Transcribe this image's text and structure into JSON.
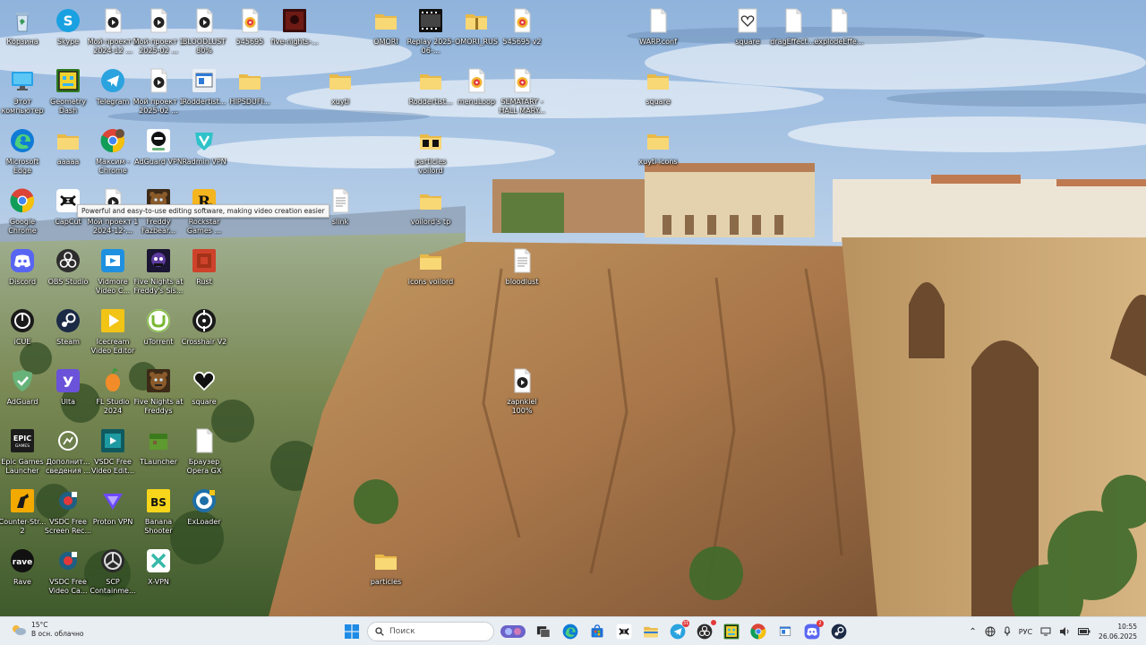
{
  "desktop": {
    "tooltip": "Powerful and easy-to-use editing software, making video creation easier",
    "icons": [
      {
        "label": "Корзина",
        "icon": "recycle-bin-icon",
        "kind": "bin"
      },
      {
        "label": "Skype",
        "icon": "skype-icon",
        "kind": "skype"
      },
      {
        "label": "Мой проект 1 2024-12 ...",
        "icon": "video-file-icon",
        "kind": "video"
      },
      {
        "label": "Мой проект 1 2025-02 ...",
        "icon": "video-file-icon",
        "kind": "video"
      },
      {
        "label": "BLOODLUST 80%",
        "icon": "video-file-icon",
        "kind": "video"
      },
      {
        "label": "545695",
        "icon": "audio-file-icon",
        "kind": "audio"
      },
      {
        "label": "five-nights-...",
        "icon": "game-thumbnail-icon",
        "kind": "thumb"
      },
      {
        "label": "OMORI",
        "icon": "folder-icon",
        "kind": "folder"
      },
      {
        "label": "Replay 2025-06-...",
        "icon": "video-thumbnail-icon",
        "kind": "film"
      },
      {
        "label": "OMORI_RUS",
        "icon": "zip-folder-icon",
        "kind": "zip"
      },
      {
        "label": "545695 v2",
        "icon": "audio-file-icon",
        "kind": "audio"
      },
      {
        "label": "WARP.conf",
        "icon": "file-icon",
        "kind": "file"
      },
      {
        "label": "square",
        "icon": "heart-file-icon",
        "kind": "heartfile"
      },
      {
        "label": "dragEffect....",
        "icon": "file-icon",
        "kind": "file"
      },
      {
        "label": "explodeEffe...",
        "icon": "file-icon",
        "kind": "file"
      },
      {
        "label": "Этот компьютер",
        "icon": "this-pc-icon",
        "kind": "pc"
      },
      {
        "label": "Geometry Dash",
        "icon": "geometry-dash-icon",
        "kind": "gd"
      },
      {
        "label": "Telegram",
        "icon": "telegram-icon",
        "kind": "telegram"
      },
      {
        "label": "Мой проект 1 2025-02 ...",
        "icon": "video-file-icon",
        "kind": "video"
      },
      {
        "label": "Roddertist...",
        "icon": "app-window-icon",
        "kind": "window"
      },
      {
        "label": "HIPSDUFI...",
        "icon": "folder-icon",
        "kind": "folder"
      },
      {
        "label": "xuyti",
        "icon": "folder-icon",
        "kind": "folder"
      },
      {
        "label": "Roddertist...",
        "icon": "folder-icon",
        "kind": "folder"
      },
      {
        "label": "menuLoop",
        "icon": "audio-file-icon",
        "kind": "audio"
      },
      {
        "label": "SEMATARY - HALL MARY...",
        "icon": "audio-file-icon",
        "kind": "audio"
      },
      {
        "label": "square",
        "icon": "folder-icon",
        "kind": "folder"
      },
      {
        "label": "Microsoft Edge",
        "icon": "edge-icon",
        "kind": "edge"
      },
      {
        "label": "ааааа",
        "icon": "folder-icon",
        "kind": "folder"
      },
      {
        "label": "Максим - Chrome",
        "icon": "chrome-profile-icon",
        "kind": "chromeprof"
      },
      {
        "label": "AdGuard VPN",
        "icon": "adguard-vpn-icon",
        "kind": "adguardvpn"
      },
      {
        "label": "Radmin VPN",
        "icon": "radmin-vpn-icon",
        "kind": "radmin"
      },
      {
        "label": "particles voilord",
        "icon": "folder-icon",
        "kind": "folderdark"
      },
      {
        "label": "xuyti icons",
        "icon": "folder-icon",
        "kind": "folder"
      },
      {
        "label": "Google Chrome",
        "icon": "chrome-icon",
        "kind": "chrome"
      },
      {
        "label": "CapCut",
        "icon": "capcut-icon",
        "kind": "capcut"
      },
      {
        "label": "Мой проект 1 2024-12-...",
        "icon": "video-file-icon",
        "kind": "video"
      },
      {
        "label": "Freddy Fazbear...",
        "icon": "fnaf-icon",
        "kind": "freddy"
      },
      {
        "label": "Rockstar Games ...",
        "icon": "rockstar-icon",
        "kind": "rockstar"
      },
      {
        "label": "slink",
        "icon": "text-file-icon",
        "kind": "textfile"
      },
      {
        "label": "voilord's tp",
        "icon": "folder-icon",
        "kind": "folder"
      },
      {
        "label": "Discord",
        "icon": "discord-icon",
        "kind": "discord"
      },
      {
        "label": "OBS Studio",
        "icon": "obs-icon",
        "kind": "obs"
      },
      {
        "label": "Vidmore Video C...",
        "icon": "vidmore-icon",
        "kind": "vidmore"
      },
      {
        "label": "Five Nights at Freddy's Sis...",
        "icon": "fnaf-sl-icon",
        "kind": "fnafsl"
      },
      {
        "label": "Rust",
        "icon": "rust-icon",
        "kind": "rust"
      },
      {
        "label": "icons voilord",
        "icon": "folder-icon",
        "kind": "folder"
      },
      {
        "label": "bloodlust",
        "icon": "text-file-icon",
        "kind": "textfile"
      },
      {
        "label": "iCUE",
        "icon": "icue-icon",
        "kind": "icue"
      },
      {
        "label": "Steam",
        "icon": "steam-icon",
        "kind": "steam"
      },
      {
        "label": "Icecream Video Editor",
        "icon": "icecream-icon",
        "kind": "icecream"
      },
      {
        "label": "uTorrent",
        "icon": "utorrent-icon",
        "kind": "utorrent"
      },
      {
        "label": "Crosshair V2",
        "icon": "crosshair-icon",
        "kind": "crosshair"
      },
      {
        "label": "AdGuard",
        "icon": "adguard-icon",
        "kind": "adguard"
      },
      {
        "label": "Ulta",
        "icon": "ulta-icon",
        "kind": "ulta"
      },
      {
        "label": "FL Studio 2024",
        "icon": "fl-studio-icon",
        "kind": "fl"
      },
      {
        "label": "Five Nights at Freddys",
        "icon": "fnaf-icon",
        "kind": "freddy"
      },
      {
        "label": "square",
        "icon": "heart-icon",
        "kind": "heart"
      },
      {
        "label": "zapnkiel 100%",
        "icon": "video-file-icon",
        "kind": "video"
      },
      {
        "label": "Epic Games Launcher",
        "icon": "epic-games-icon",
        "kind": "epic"
      },
      {
        "label": "Дополнит... сведения ...",
        "icon": "info-icon",
        "kind": "info"
      },
      {
        "label": "VSDC Free Video Edit...",
        "icon": "vsdc-editor-icon",
        "kind": "vsdc"
      },
      {
        "label": "TLauncher",
        "icon": "tlauncher-icon",
        "kind": "tlauncher"
      },
      {
        "label": "Браузер Opera GX",
        "icon": "file-icon",
        "kind": "file"
      },
      {
        "label": "Counter-Str... 2",
        "icon": "cs2-icon",
        "kind": "cs"
      },
      {
        "label": "VSDC Free Screen Rec...",
        "icon": "vsdc-recorder-icon",
        "kind": "vsdcrec"
      },
      {
        "label": "Proton VPN",
        "icon": "proton-vpn-icon",
        "kind": "proton"
      },
      {
        "label": "Banana Shooter",
        "icon": "banana-shooter-icon",
        "kind": "banana"
      },
      {
        "label": "ExLoader",
        "icon": "exloader-icon",
        "kind": "exloader"
      },
      {
        "label": "Rave",
        "icon": "rave-icon",
        "kind": "rave"
      },
      {
        "label": "VSDC Free Video Ca...",
        "icon": "vsdc-capture-icon",
        "kind": "vsdcrec"
      },
      {
        "label": "SCP Containme...",
        "icon": "scp-icon",
        "kind": "scp"
      },
      {
        "label": "X-VPN",
        "icon": "x-vpn-icon",
        "kind": "xvpn"
      },
      {
        "label": "particles",
        "icon": "folder-icon",
        "kind": "folder"
      }
    ]
  },
  "taskbar": {
    "weather": {
      "temp": "15°C",
      "desc": "В осн. облачно",
      "icon": "weather-cloud-sun-icon"
    },
    "search_placeholder": "Поиск",
    "pinned": [
      {
        "icon": "search-highlight-icon",
        "kind": "highlight"
      },
      {
        "icon": "task-view-icon",
        "kind": "taskview"
      },
      {
        "icon": "edge-icon",
        "kind": "edge"
      },
      {
        "icon": "store-icon",
        "kind": "store"
      },
      {
        "icon": "capcut-icon",
        "kind": "capcut"
      },
      {
        "icon": "file-explorer-icon",
        "kind": "explorer"
      },
      {
        "icon": "telegram-icon",
        "kind": "telegram",
        "badge": "31"
      },
      {
        "icon": "obs-icon",
        "kind": "obs",
        "dot": true
      },
      {
        "icon": "geometry-dash-icon",
        "kind": "gd"
      },
      {
        "icon": "chrome-icon",
        "kind": "chrome"
      },
      {
        "icon": "app-window-icon",
        "kind": "window"
      },
      {
        "icon": "discord-icon",
        "kind": "discord",
        "badge": "2"
      },
      {
        "icon": "steam-icon",
        "kind": "steam"
      }
    ],
    "tray": {
      "language": "РУС",
      "time": "10:55",
      "date": "26.06.2025"
    }
  }
}
